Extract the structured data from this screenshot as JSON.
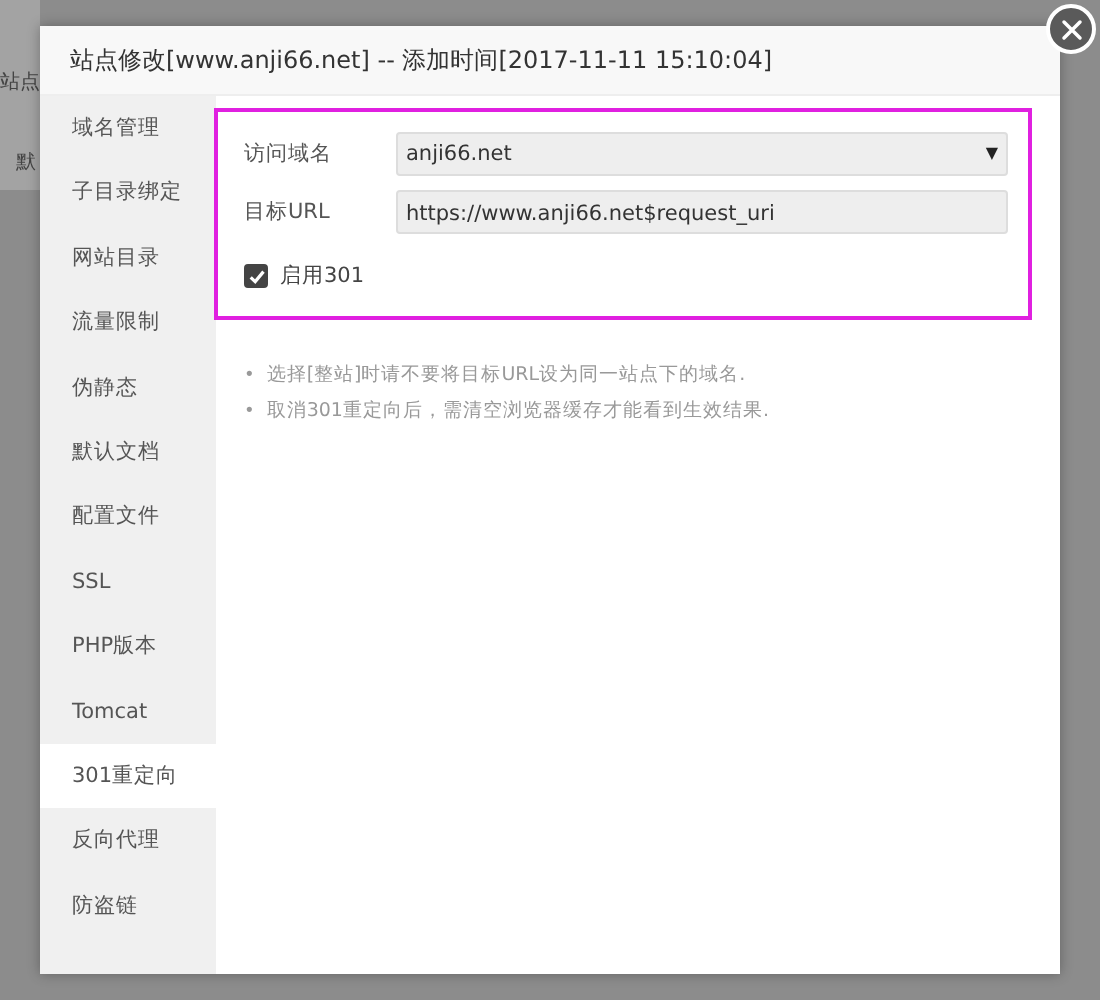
{
  "background_page": {
    "texts": [
      "站点",
      "默"
    ]
  },
  "dialog": {
    "title": "站点修改[www.anji66.net] -- 添加时间[2017-11-11 15:10:04]",
    "sidebar": {
      "items": [
        {
          "label": "域名管理",
          "selected": false
        },
        {
          "label": "子目录绑定",
          "selected": false
        },
        {
          "label": "网站目录",
          "selected": false
        },
        {
          "label": "流量限制",
          "selected": false
        },
        {
          "label": "伪静态",
          "selected": false
        },
        {
          "label": "默认文档",
          "selected": false
        },
        {
          "label": "配置文件",
          "selected": false
        },
        {
          "label": "SSL",
          "selected": false
        },
        {
          "label": "PHP版本",
          "selected": false
        },
        {
          "label": "Tomcat",
          "selected": false
        },
        {
          "label": "301重定向",
          "selected": true
        },
        {
          "label": "反向代理",
          "selected": false
        },
        {
          "label": "防盗链",
          "selected": false
        }
      ]
    },
    "form": {
      "fields": [
        {
          "kind": "select",
          "label": "访问域名",
          "value": "anji66.net",
          "caret": "▼"
        },
        {
          "kind": "text",
          "label": "目标URL",
          "value": "https://www.anji66.net$request_uri"
        }
      ],
      "checkbox": {
        "label": "启用301",
        "checked": true
      }
    },
    "tips": [
      {
        "bullet": "•",
        "text": "选择[整站]时请不要将目标URL设为同一站点下的域名."
      },
      {
        "bullet": "•",
        "text": "取消301重定向后，需清空浏览器缓存才能看到生效结果."
      }
    ]
  }
}
